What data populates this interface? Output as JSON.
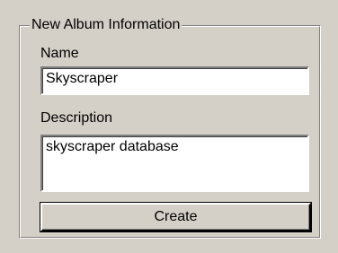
{
  "group": {
    "title": "New Album Information"
  },
  "name_field": {
    "label": "Name",
    "value": "Skyscraper"
  },
  "description_field": {
    "label": "Description",
    "value": "skyscraper database"
  },
  "create_button": {
    "label": "Create"
  }
}
